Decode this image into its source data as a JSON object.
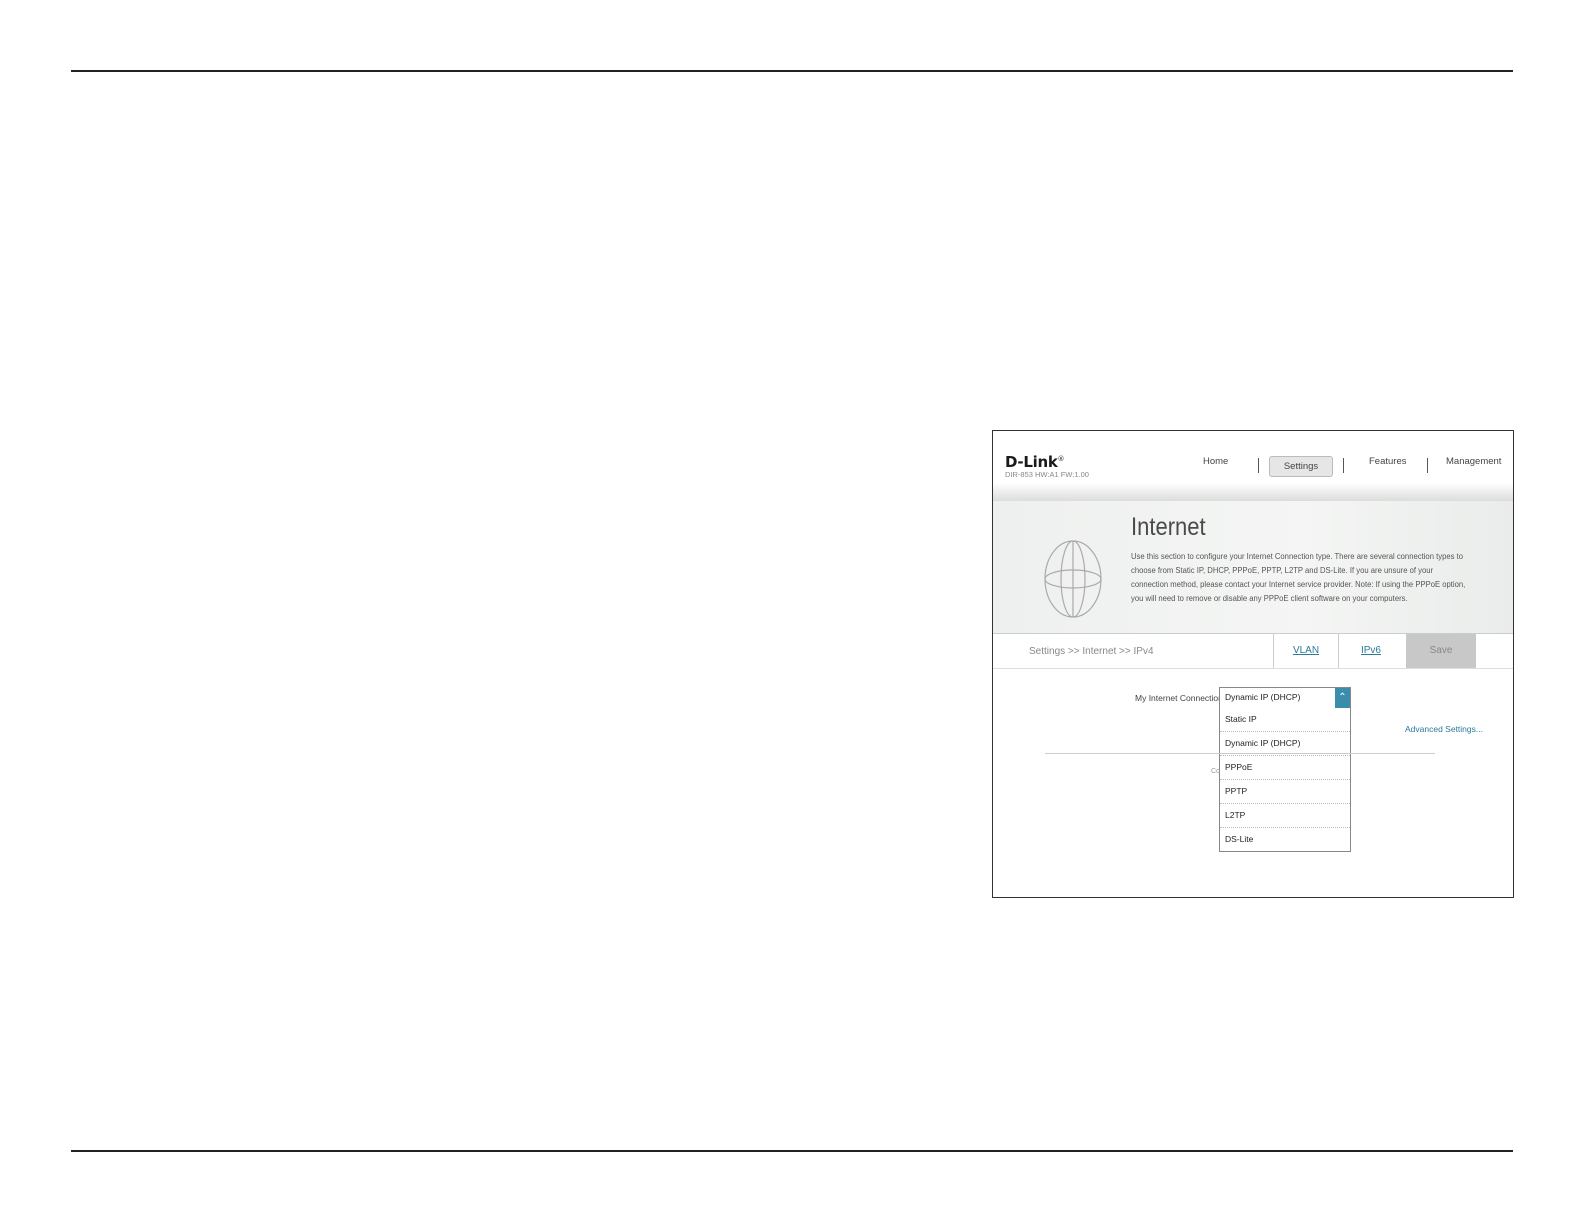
{
  "header": {
    "logo": "D-Link",
    "logo_mark": "®",
    "model": "DIR-853 HW:A1 FW:1.00",
    "nav": {
      "home": "Home",
      "settings": "Settings",
      "features": "Features",
      "management": "Management"
    }
  },
  "banner": {
    "title": "Internet",
    "description": "Use this section to configure your Internet Connection type. There are several connection types to choose from Static IP, DHCP, PPPoE, PPTP, L2TP and DS-Lite. If you are unsure of your connection method, please contact your Internet service provider. Note: If using the PPPoE option, you will need to remove or disable any PPPoE client software on your computers."
  },
  "toolbar": {
    "breadcrumb": "Settings >> Internet >> IPv4",
    "vlan": "VLAN",
    "ipv6": "IPv6",
    "save": "Save"
  },
  "form": {
    "connection_label": "My Internet Connection is:",
    "connection_value": "Dynamic IP (DHCP)",
    "options": [
      "Static IP",
      "Dynamic IP (DHCP)",
      "PPPoE",
      "PPTP",
      "L2TP",
      "DS-Lite"
    ],
    "advanced": "Advanced Settings...",
    "partial_text": "Co"
  },
  "colors": {
    "accent": "#3a8eab",
    "link": "#2a7a9a"
  }
}
